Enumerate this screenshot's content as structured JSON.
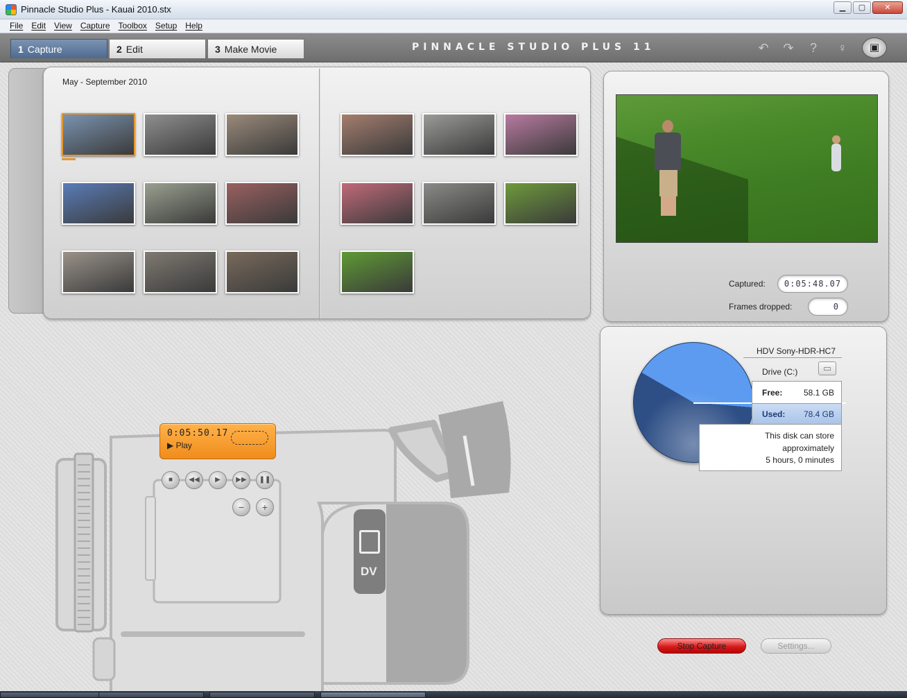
{
  "window": {
    "title": "Pinnacle Studio Plus - Kauai 2010.stx",
    "minimize": "▁",
    "maximize": "▢",
    "close": "✕"
  },
  "menu": [
    "File",
    "Edit",
    "View",
    "Capture",
    "Toolbox",
    "Setup",
    "Help"
  ],
  "tabs": [
    {
      "num": "1",
      "label": "Capture"
    },
    {
      "num": "2",
      "label": "Edit"
    },
    {
      "num": "3",
      "label": "Make Movie"
    }
  ],
  "brand": "PINNACLE STUDIO PLUS 11",
  "header_icons": [
    "undo-icon",
    "redo-icon",
    "help-icon",
    "tips-lightbulb-icon",
    "disc-icon"
  ],
  "album": {
    "title": "May - September 2010",
    "thumbnails": [
      {
        "id": "bridge",
        "color": "#7a93b0"
      },
      {
        "id": "shadows",
        "color": "#8f8f8f"
      },
      {
        "id": "people-sitting",
        "color": "#9a8a7a"
      },
      {
        "id": "boy-red-shirt",
        "color": "#a47e6e"
      },
      {
        "id": "kid-running",
        "color": "#9a9a98"
      },
      {
        "id": "colorful-market",
        "color": "#b87aa0"
      },
      {
        "id": "clock-tower",
        "color": "#5a7cb8"
      },
      {
        "id": "aerial-view",
        "color": "#9aa090"
      },
      {
        "id": "brick-plaza",
        "color": "#9a6060"
      },
      {
        "id": "tie-dye-shirts",
        "color": "#c06a7a"
      },
      {
        "id": "steps-crowd",
        "color": "#8a8a88"
      },
      {
        "id": "kid-on-grass",
        "color": "#6e9a3c"
      },
      {
        "id": "fountain-sculpture",
        "color": "#9a928a"
      },
      {
        "id": "fountain-walk",
        "color": "#7f7a72"
      },
      {
        "id": "waterfall-wall",
        "color": "#786a5c"
      },
      {
        "id": "green-lawn",
        "color": "#5f9a34"
      }
    ]
  },
  "preview": {
    "captured_label": "Captured:",
    "captured_value": "0:05:48.07",
    "frames_dropped_label": "Frames dropped:",
    "frames_dropped_value": "0"
  },
  "camcorder": {
    "timecode": "0:05:50.17",
    "mode": "▶ Play",
    "buttons": [
      "stop-icon",
      "rewind-icon",
      "play-icon",
      "fast-forward-icon",
      "pause-icon"
    ],
    "volume_down": "−",
    "volume_up": "+",
    "badge": "DV"
  },
  "disk": {
    "device": "HDV Sony-HDR-HC7",
    "drive": "Drive (C:)",
    "free_label": "Free:",
    "free_value": "58.1 GB",
    "used_label": "Used:",
    "used_value": "78.4 GB",
    "note_line1": "This disk can store",
    "note_line2": "approximately",
    "note_line3": "5 hours, 0 minutes",
    "free_fraction": 0.43,
    "colors": {
      "free": "#5c9bf0",
      "used": "#2e4f86"
    }
  },
  "actions": {
    "stop_capture": "Stop Capture",
    "settings": "Settings..."
  }
}
